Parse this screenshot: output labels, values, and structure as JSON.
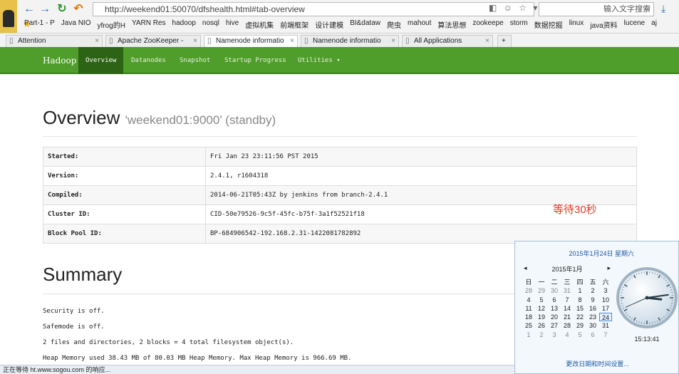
{
  "browser": {
    "url_path": "http://weekend01:50070/dfshealth.html#tab-overview",
    "search_placeholder": "输入文字搜索",
    "bookmarks": [
      "Part-1 - P",
      "Java NIO",
      "yfrog的H",
      "YARN Res",
      "hadoop",
      "nosql",
      "hive",
      "虚拟机集",
      "前端框架",
      "设计建模",
      "BI&dataw",
      "爬虫",
      "mahout",
      "算法思想",
      "zookeepe",
      "storm",
      "数据挖掘",
      "linux",
      "java资料",
      "lucene",
      "aj"
    ],
    "tabs": [
      "Attention",
      "Apache ZooKeeper -",
      "Namenode informatio",
      "Namenode informatio",
      "All Applications"
    ]
  },
  "nav": {
    "brand": "Hadoop",
    "items": [
      "Overview",
      "Datanodes",
      "Snapshot",
      "Startup Progress",
      "Utilities"
    ]
  },
  "overview": {
    "title": "Overview",
    "subtitle": "'weekend01:9000' (standby)",
    "rows": [
      {
        "key": "Started:",
        "value": "Fri Jan 23 23:11:56 PST 2015"
      },
      {
        "key": "Version:",
        "value": "2.4.1, r1604318"
      },
      {
        "key": "Compiled:",
        "value": "2014-06-21T05:43Z by jenkins from branch-2.4.1"
      },
      {
        "key": "Cluster ID:",
        "value": "CID-50e79526-9c5f-45fc-b75f-3a1f52521f18"
      },
      {
        "key": "Block Pool ID:",
        "value": "BP-684906542-192.168.2.31-1422081782892"
      }
    ]
  },
  "annotation": "等待30秒",
  "summary": {
    "title": "Summary",
    "lines": [
      "Security is off.",
      "Safemode is off.",
      "2 files and directories, 2 blocks = 4 total filesystem object(s).",
      "Heap Memory used 38.43 MB of 80.03 MB Heap Memory. Max Heap Memory is 966.69 MB."
    ]
  },
  "status_bar": "正在等待 ht.www.sogou.com 的响应...",
  "clock_panel": {
    "date_line": "2015年1月24日 星期六",
    "month": "2015年1月",
    "weekdays": [
      "日",
      "一",
      "二",
      "三",
      "四",
      "五",
      "六"
    ],
    "days": [
      {
        "d": "28",
        "dim": true
      },
      {
        "d": "29",
        "dim": true
      },
      {
        "d": "30",
        "dim": true
      },
      {
        "d": "31",
        "dim": true
      },
      {
        "d": "1"
      },
      {
        "d": "2"
      },
      {
        "d": "3"
      },
      {
        "d": "4"
      },
      {
        "d": "5"
      },
      {
        "d": "6"
      },
      {
        "d": "7"
      },
      {
        "d": "8"
      },
      {
        "d": "9"
      },
      {
        "d": "10"
      },
      {
        "d": "11"
      },
      {
        "d": "12"
      },
      {
        "d": "13"
      },
      {
        "d": "14"
      },
      {
        "d": "15"
      },
      {
        "d": "16"
      },
      {
        "d": "17"
      },
      {
        "d": "18"
      },
      {
        "d": "19"
      },
      {
        "d": "20"
      },
      {
        "d": "21"
      },
      {
        "d": "22"
      },
      {
        "d": "23"
      },
      {
        "d": "24",
        "today": true
      },
      {
        "d": "25"
      },
      {
        "d": "26"
      },
      {
        "d": "27"
      },
      {
        "d": "28"
      },
      {
        "d": "29"
      },
      {
        "d": "30"
      },
      {
        "d": "31"
      },
      {
        "d": "1",
        "dim": true
      },
      {
        "d": "2",
        "dim": true
      },
      {
        "d": "3",
        "dim": true
      },
      {
        "d": "4",
        "dim": true
      },
      {
        "d": "5",
        "dim": true
      },
      {
        "d": "6",
        "dim": true
      },
      {
        "d": "7",
        "dim": true
      }
    ],
    "time": "15:13:41",
    "change_link": "更改日期和时间设置..."
  }
}
